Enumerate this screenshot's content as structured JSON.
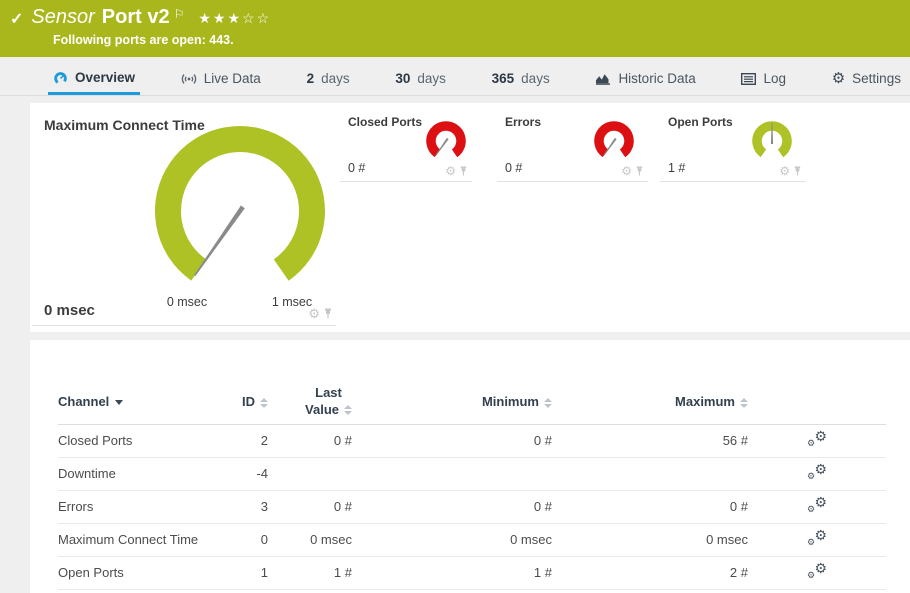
{
  "banner": {
    "check": "✓",
    "title_category": "Sensor",
    "title_name": "Port v2",
    "flag": "⚐",
    "rating": {
      "filled": 3,
      "total": 5
    },
    "message": "Following ports are open: 443."
  },
  "tabs": {
    "overview": {
      "label": "Overview"
    },
    "live_data": {
      "label": "Live Data"
    },
    "days2": {
      "number": "2",
      "unit": "days"
    },
    "days30": {
      "number": "30",
      "unit": "days"
    },
    "days365": {
      "number": "365",
      "unit": "days"
    },
    "historic": {
      "label": "Historic Data"
    },
    "log": {
      "label": "Log"
    },
    "settings": {
      "label": "Settings"
    }
  },
  "gauges": {
    "maximum_connect_time": {
      "title": "Maximum Connect Time",
      "value": "0 msec",
      "scale_start": "0 msec",
      "scale_end": "1 msec",
      "needle_fraction": 0,
      "color": "#aec226"
    },
    "closed_ports": {
      "title": "Closed Ports",
      "value": "0 #",
      "needle_fraction": 0,
      "color": "#dc1012"
    },
    "errors": {
      "title": "Errors",
      "value": "0 #",
      "needle_fraction": 0,
      "color": "#dc1012"
    },
    "open_ports": {
      "title": "Open Ports",
      "value": "1 #",
      "needle_fraction": 0.5,
      "color": "#aec226"
    }
  },
  "table": {
    "headers": {
      "channel": "Channel",
      "id": "ID",
      "last_line1": "Last",
      "last_line2": "Value",
      "minimum": "Minimum",
      "maximum": "Maximum"
    },
    "rows": [
      {
        "channel": "Closed Ports",
        "id": "2",
        "last": "0 #",
        "min": "0 #",
        "max": "56 #"
      },
      {
        "channel": "Downtime",
        "id": "-4",
        "last": "",
        "min": "",
        "max": ""
      },
      {
        "channel": "Errors",
        "id": "3",
        "last": "0 #",
        "min": "0 #",
        "max": "0 #"
      },
      {
        "channel": "Maximum Connect Time",
        "id": "0",
        "last": "0 msec",
        "min": "0 msec",
        "max": "0 msec"
      },
      {
        "channel": "Open Ports",
        "id": "1",
        "last": "1 #",
        "min": "1 #",
        "max": "2 #"
      }
    ]
  },
  "icons": {
    "star_filled": "★",
    "star_empty": "☆",
    "gear": "⚙"
  },
  "colors": {
    "banner_green": "#a9b71c",
    "gauge_green": "#aec226",
    "gauge_red": "#dc1012",
    "accent_blue": "#1b9bd7"
  }
}
